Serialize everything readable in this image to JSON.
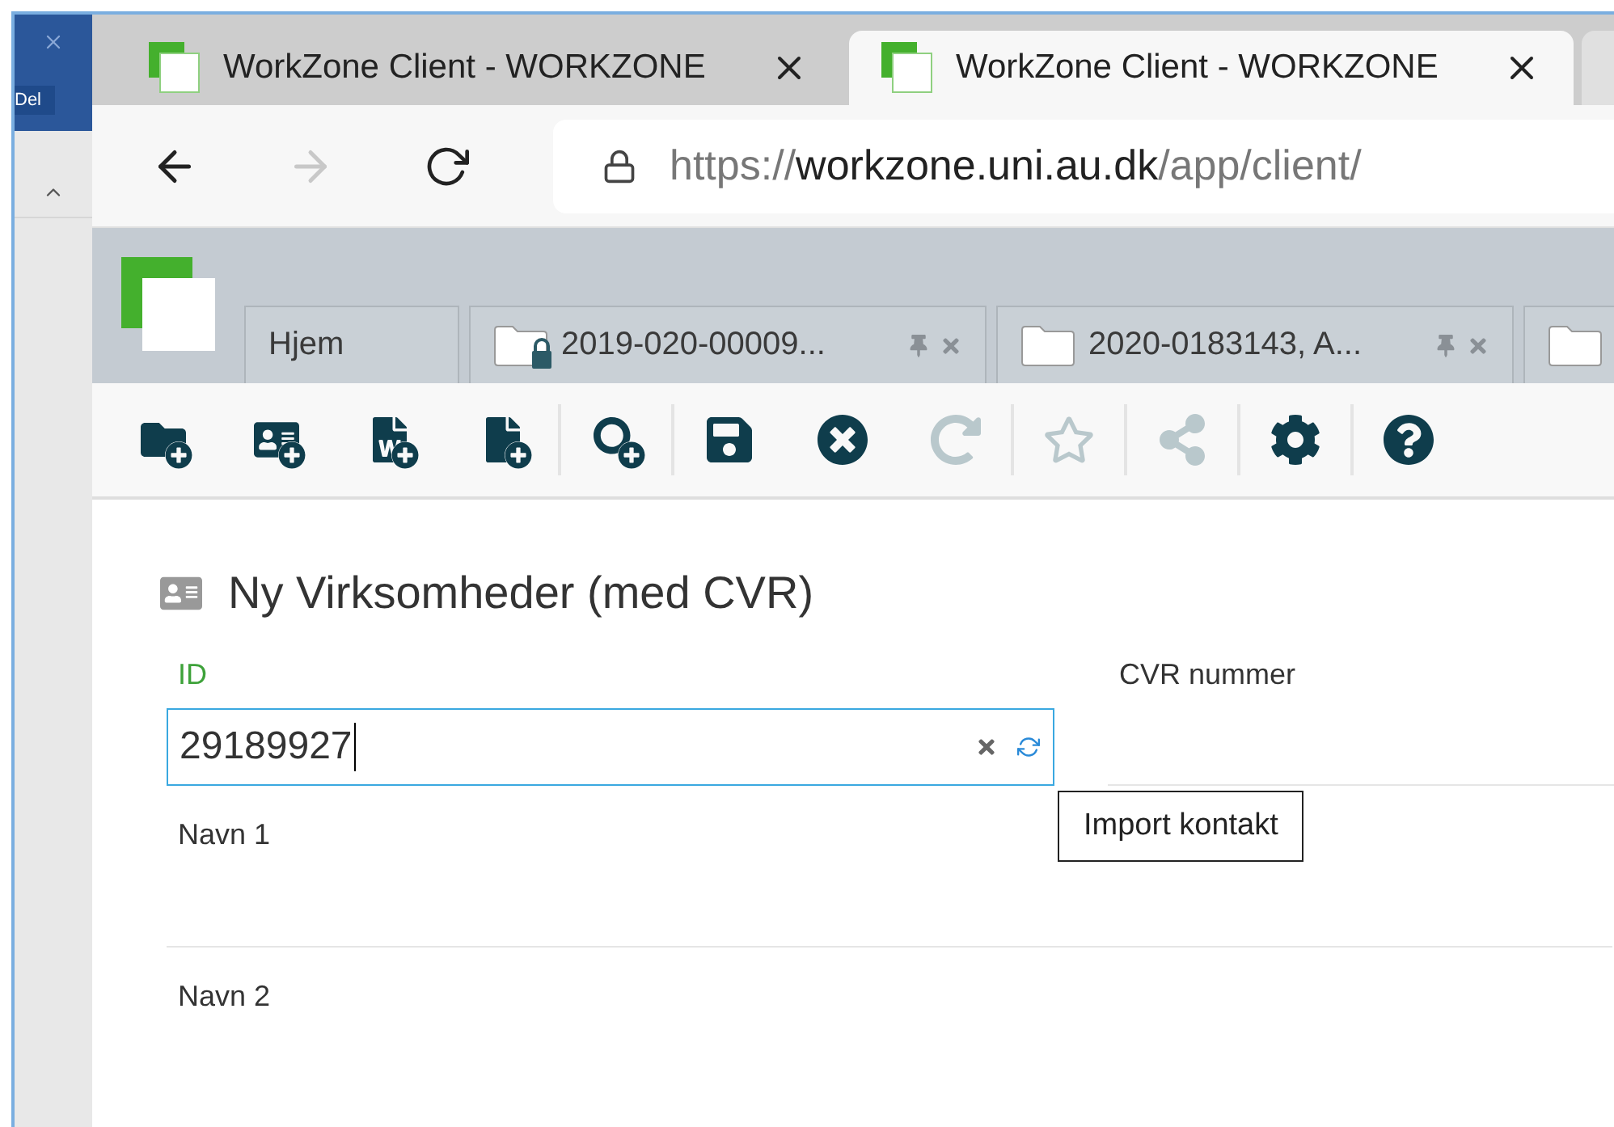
{
  "side_window": {
    "label": "Del"
  },
  "browser_tabs": [
    {
      "title": "WorkZone Client - WORKZONE",
      "selected": false
    },
    {
      "title": "WorkZone Client - WORKZONE",
      "selected": true
    }
  ],
  "address_bar": {
    "scheme": "https://",
    "host": "workzone.uni.au.dk",
    "path": "/app/client/",
    "forward_disabled": true
  },
  "app_tabs": [
    {
      "kind": "home",
      "label": "Hjem"
    },
    {
      "kind": "case",
      "label": "2019-020-00009...",
      "locked": true
    },
    {
      "kind": "case",
      "label": "2020-0183143, A...",
      "locked": false
    },
    {
      "kind": "case",
      "locked": false
    }
  ],
  "toolbar": [
    [
      {
        "kind": "folder-add",
        "disabled": false
      },
      {
        "kind": "contact-add",
        "disabled": false
      },
      {
        "kind": "word-add",
        "disabled": false
      },
      {
        "kind": "document-add",
        "disabled": false
      }
    ],
    [
      {
        "kind": "search-add",
        "disabled": false
      }
    ],
    [
      {
        "kind": "save",
        "disabled": false
      },
      {
        "kind": "cancel",
        "disabled": false
      },
      {
        "kind": "redo",
        "disabled": true
      }
    ],
    [
      {
        "kind": "star",
        "disabled": true
      }
    ],
    [
      {
        "kind": "share",
        "disabled": true
      }
    ],
    [
      {
        "kind": "settings",
        "disabled": false
      }
    ],
    [
      {
        "kind": "help",
        "disabled": false
      }
    ]
  ],
  "form": {
    "title": "Ny Virksomheder (med CVR)",
    "id_field": {
      "label": "ID",
      "value": "29189927",
      "focused": true
    },
    "cvr_field": {
      "label": "CVR nummer"
    },
    "tooltip": "Import kontakt",
    "name_fields": [
      {
        "label": "Navn 1"
      },
      {
        "label": "Navn 2"
      }
    ]
  }
}
